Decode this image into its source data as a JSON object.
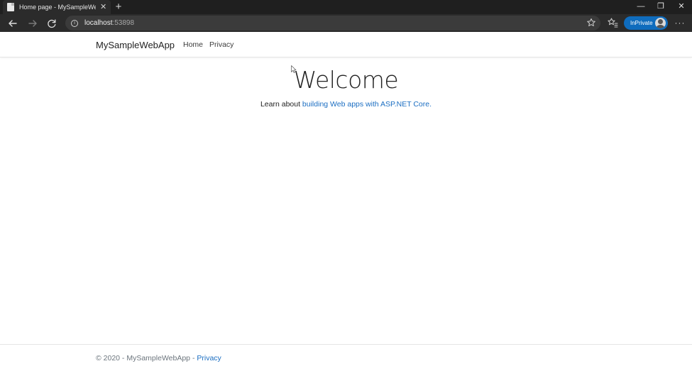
{
  "browser": {
    "tab_title": "Home page - MySampleWebApp",
    "tab_close": "✕",
    "new_tab": "+",
    "url_host": "localhost",
    "url_port": ":53898",
    "inprivate_label": "InPrivate",
    "more": "···",
    "window_controls": {
      "minimize": "—",
      "restore": "❐",
      "close": "✕"
    }
  },
  "navbar": {
    "brand": "MySampleWebApp",
    "links": [
      "Home",
      "Privacy"
    ]
  },
  "main": {
    "heading": "Welcome",
    "learn_prefix": "Learn about ",
    "learn_link": "building Web apps with ASP.NET Core."
  },
  "footer": {
    "text": "© 2020 - MySampleWebApp - ",
    "privacy_link": "Privacy"
  },
  "colors": {
    "link": "#1b6ec2",
    "inprivate": "#0f6cbd",
    "chrome_dark": "#1f1f1f"
  }
}
